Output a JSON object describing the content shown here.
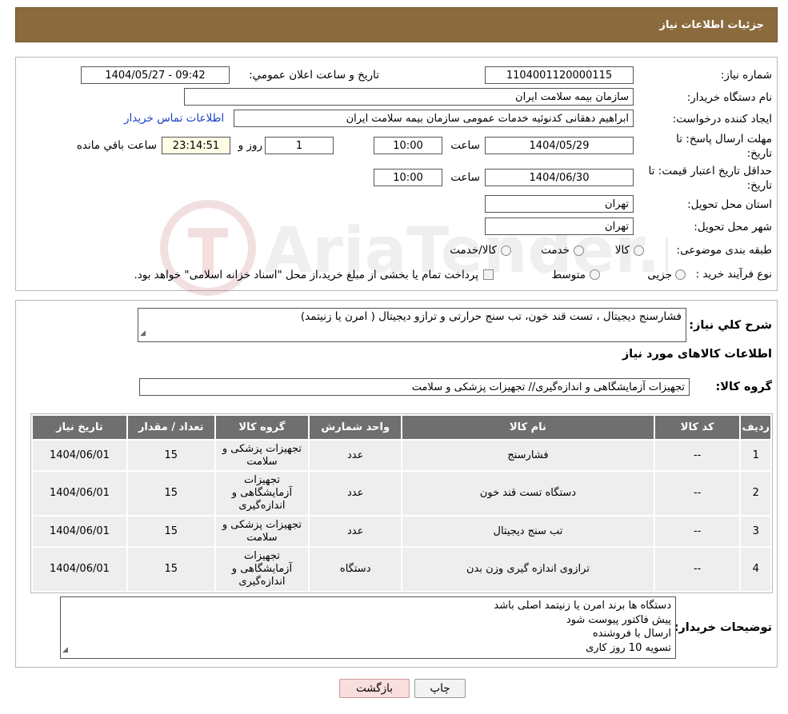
{
  "header": {
    "title": "جزئیات اطلاعات نیاز"
  },
  "form": {
    "need_number_label": "شماره نیاز:",
    "need_number_value": "1104001120000115",
    "announce_label": "تاریخ و ساعت اعلان عمومي:",
    "announce_value": "1404/05/27 - 09:42",
    "buyer_label": "نام دستگاه خریدار:",
    "buyer_value": "سازمان بیمه سلامت ایران",
    "creator_label": "ایجاد کننده درخواست:",
    "creator_value": "ابراهیم دهقانی کدنوئیه خدمات عمومی سازمان بیمه سلامت ایران",
    "contact_link": "اطلاعات تماس خریدار",
    "reply_deadline_label_1": "مهلت ارسال پاسخ: تا",
    "reply_deadline_label_2": "تاریخ:",
    "reply_date": "1404/05/29",
    "time_label": "ساعت",
    "reply_time": "10:00",
    "days_value": "1",
    "days_label": "روز و",
    "remaining_time": "23:14:51",
    "remaining_label": "ساعت باقي مانده",
    "validity_label_1": "حداقل تاریخ اعتبار قیمت: تا",
    "validity_label_2": "تاریخ:",
    "validity_date": "1404/06/30",
    "validity_time": "10:00",
    "province_label": "استان محل تحویل:",
    "province_value": "تهران",
    "city_label": "شهر محل تحویل:",
    "city_value": "تهران",
    "category_label": "طبقه بندی موضوعی:",
    "category_options": [
      "کالا",
      "خدمت",
      "کالا/خدمت"
    ],
    "process_label": "نوع فرآیند خرید :",
    "process_options": [
      "جزیی",
      "متوسط"
    ],
    "process_note": "پرداخت تمام یا بخشی از مبلغ خرید،از محل \"اسناد خزانه اسلامی\" خواهد بود."
  },
  "summary": {
    "label": "شرح كلي نیاز:",
    "value": "فشارسنج دیجیتال ، تست قند خون، تب سنج حرارتی و ترازو دیجیتال ( امرن یا زنیتمد)",
    "goods_info_title": "اطلاعات کالاهای مورد نیاز",
    "goods_group_label": "گروه کالا:",
    "goods_group_value": "تجهیزات آزمایشگاهی و اندازه‌گیری// تجهیزات پزشکی و سلامت"
  },
  "table": {
    "headers": [
      "ردیف",
      "کد کالا",
      "نام کالا",
      "واحد شمارش",
      "گروه کالا",
      "تعداد / مقدار",
      "تاریخ نیاز"
    ],
    "rows": [
      [
        "1",
        "--",
        "فشارسنج",
        "عدد",
        "تجهیزات پزشکی و سلامت",
        "15",
        "1404/06/01"
      ],
      [
        "2",
        "--",
        "دستگاه تست قند خون",
        "عدد",
        "تجهیزات آزمایشگاهی و اندازه‌گیری",
        "15",
        "1404/06/01"
      ],
      [
        "3",
        "--",
        "تب سنج دیجیتال",
        "عدد",
        "تجهیزات پزشکی و سلامت",
        "15",
        "1404/06/01"
      ],
      [
        "4",
        "--",
        "ترازوی اندازه گیری وزن بدن",
        "دستگاه",
        "تجهیزات آزمایشگاهی و اندازه‌گیری",
        "15",
        "1404/06/01"
      ]
    ]
  },
  "buyer_notes": {
    "label": "توضیحات خریدار:",
    "lines": [
      "دستگاه ها برند امرن یا زنیتمد اصلی باشد",
      "پیش فاکتور پیوست شود",
      "ارسال با فروشنده",
      "تسویه 10 روز کاری"
    ]
  },
  "buttons": {
    "print": "چاپ",
    "back": "بازگشت"
  },
  "watermark_text": "AriaTender.neT",
  "colors": {
    "header": "#8b6b3e",
    "table_header": "#6f6f6f",
    "link": "#1a40c4",
    "back_button": "#f9dede"
  }
}
